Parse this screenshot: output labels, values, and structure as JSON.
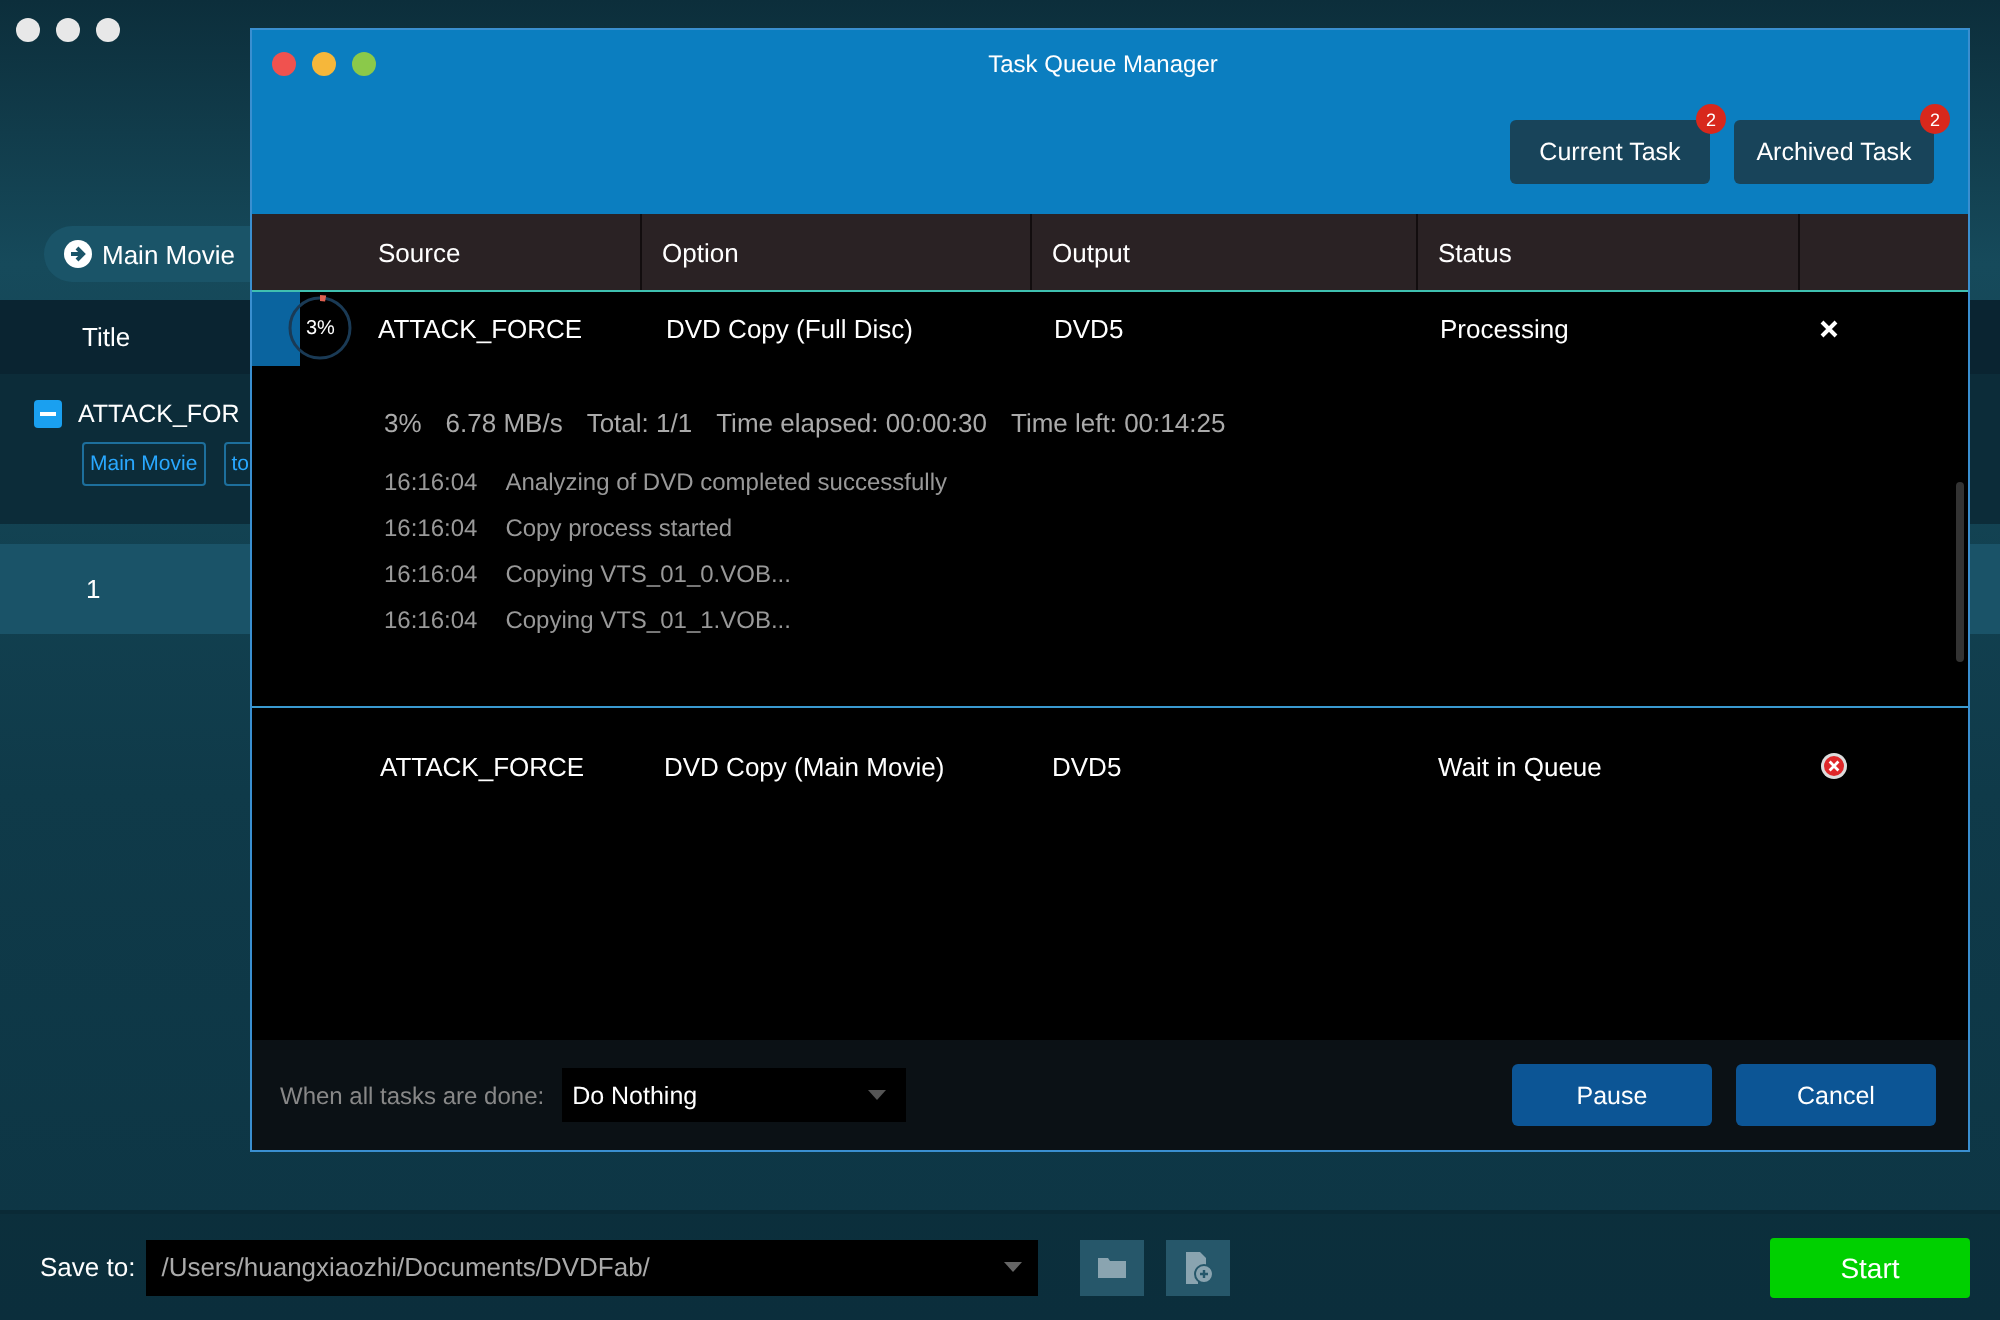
{
  "app": {
    "mode_button": "Main Movie",
    "table_header": "Title",
    "title_item": {
      "name": "ATTACK_FOR",
      "tags": [
        "Main Movie",
        "to"
      ]
    },
    "rows": [
      {
        "label": "1",
        "selected": true
      }
    ],
    "save_to": {
      "label": "Save to:",
      "path": "/Users/huangxiaozhi/Documents/DVDFab/"
    },
    "start_button": "Start"
  },
  "dialog": {
    "title": "Task Queue Manager",
    "tabs": [
      {
        "label": "Current Task",
        "badge": "2"
      },
      {
        "label": "Archived Task",
        "badge": "2"
      }
    ],
    "columns": [
      "Source",
      "Option",
      "Output",
      "Status"
    ],
    "tasks": [
      {
        "source": "ATTACK_FORCE",
        "option": "DVD Copy (Full Disc)",
        "output": "DVD5",
        "status": "Processing",
        "active": true,
        "progress_label": "3%",
        "level": 0.03,
        "stats": [
          "3%",
          "6.78 MB/s",
          "Total: 1/1",
          "Time elapsed: 00:00:30",
          "Time left: 00:14:25"
        ],
        "log": [
          {
            "time": "16:16:04",
            "message": "Analyzing of DVD completed successfully"
          },
          {
            "time": "16:16:04",
            "message": "Copy process started"
          },
          {
            "time": "16:16:04",
            "message": "Copying VTS_01_0.VOB..."
          },
          {
            "time": "16:16:04",
            "message": "Copying VTS_01_1.VOB..."
          }
        ]
      },
      {
        "source": "ATTACK_FORCE",
        "option": "DVD Copy (Main Movie)",
        "output": "DVD5",
        "status": "Wait in Queue",
        "active": false
      }
    ],
    "footer": {
      "label": "When all tasks are done:",
      "select": "Do Nothing",
      "buttons": [
        "Pause",
        "Cancel"
      ]
    }
  }
}
